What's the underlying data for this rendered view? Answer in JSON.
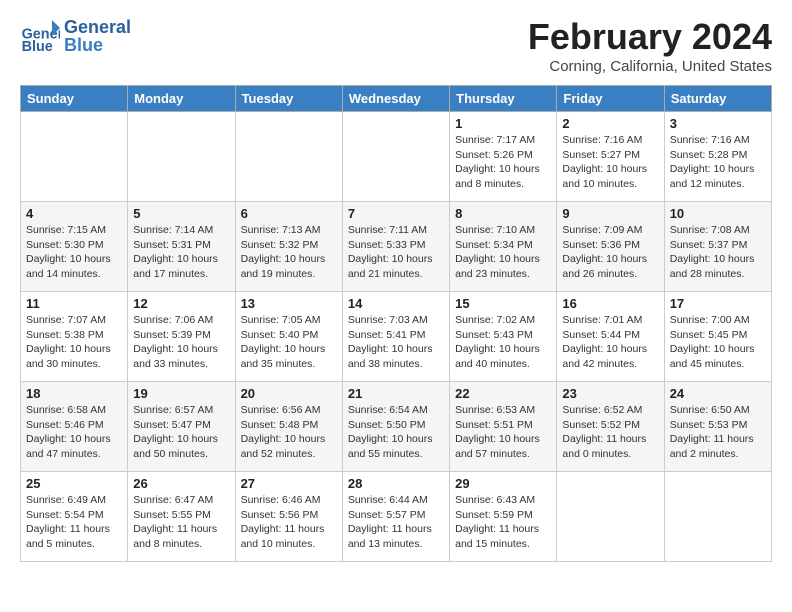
{
  "header": {
    "logo_text_general": "General",
    "logo_text_blue": "Blue",
    "month_title": "February 2024",
    "location": "Corning, California, United States"
  },
  "days_of_week": [
    "Sunday",
    "Monday",
    "Tuesday",
    "Wednesday",
    "Thursday",
    "Friday",
    "Saturday"
  ],
  "weeks": [
    [
      {
        "day": "",
        "info": ""
      },
      {
        "day": "",
        "info": ""
      },
      {
        "day": "",
        "info": ""
      },
      {
        "day": "",
        "info": ""
      },
      {
        "day": "1",
        "info": "Sunrise: 7:17 AM\nSunset: 5:26 PM\nDaylight: 10 hours\nand 8 minutes."
      },
      {
        "day": "2",
        "info": "Sunrise: 7:16 AM\nSunset: 5:27 PM\nDaylight: 10 hours\nand 10 minutes."
      },
      {
        "day": "3",
        "info": "Sunrise: 7:16 AM\nSunset: 5:28 PM\nDaylight: 10 hours\nand 12 minutes."
      }
    ],
    [
      {
        "day": "4",
        "info": "Sunrise: 7:15 AM\nSunset: 5:30 PM\nDaylight: 10 hours\nand 14 minutes."
      },
      {
        "day": "5",
        "info": "Sunrise: 7:14 AM\nSunset: 5:31 PM\nDaylight: 10 hours\nand 17 minutes."
      },
      {
        "day": "6",
        "info": "Sunrise: 7:13 AM\nSunset: 5:32 PM\nDaylight: 10 hours\nand 19 minutes."
      },
      {
        "day": "7",
        "info": "Sunrise: 7:11 AM\nSunset: 5:33 PM\nDaylight: 10 hours\nand 21 minutes."
      },
      {
        "day": "8",
        "info": "Sunrise: 7:10 AM\nSunset: 5:34 PM\nDaylight: 10 hours\nand 23 minutes."
      },
      {
        "day": "9",
        "info": "Sunrise: 7:09 AM\nSunset: 5:36 PM\nDaylight: 10 hours\nand 26 minutes."
      },
      {
        "day": "10",
        "info": "Sunrise: 7:08 AM\nSunset: 5:37 PM\nDaylight: 10 hours\nand 28 minutes."
      }
    ],
    [
      {
        "day": "11",
        "info": "Sunrise: 7:07 AM\nSunset: 5:38 PM\nDaylight: 10 hours\nand 30 minutes."
      },
      {
        "day": "12",
        "info": "Sunrise: 7:06 AM\nSunset: 5:39 PM\nDaylight: 10 hours\nand 33 minutes."
      },
      {
        "day": "13",
        "info": "Sunrise: 7:05 AM\nSunset: 5:40 PM\nDaylight: 10 hours\nand 35 minutes."
      },
      {
        "day": "14",
        "info": "Sunrise: 7:03 AM\nSunset: 5:41 PM\nDaylight: 10 hours\nand 38 minutes."
      },
      {
        "day": "15",
        "info": "Sunrise: 7:02 AM\nSunset: 5:43 PM\nDaylight: 10 hours\nand 40 minutes."
      },
      {
        "day": "16",
        "info": "Sunrise: 7:01 AM\nSunset: 5:44 PM\nDaylight: 10 hours\nand 42 minutes."
      },
      {
        "day": "17",
        "info": "Sunrise: 7:00 AM\nSunset: 5:45 PM\nDaylight: 10 hours\nand 45 minutes."
      }
    ],
    [
      {
        "day": "18",
        "info": "Sunrise: 6:58 AM\nSunset: 5:46 PM\nDaylight: 10 hours\nand 47 minutes."
      },
      {
        "day": "19",
        "info": "Sunrise: 6:57 AM\nSunset: 5:47 PM\nDaylight: 10 hours\nand 50 minutes."
      },
      {
        "day": "20",
        "info": "Sunrise: 6:56 AM\nSunset: 5:48 PM\nDaylight: 10 hours\nand 52 minutes."
      },
      {
        "day": "21",
        "info": "Sunrise: 6:54 AM\nSunset: 5:50 PM\nDaylight: 10 hours\nand 55 minutes."
      },
      {
        "day": "22",
        "info": "Sunrise: 6:53 AM\nSunset: 5:51 PM\nDaylight: 10 hours\nand 57 minutes."
      },
      {
        "day": "23",
        "info": "Sunrise: 6:52 AM\nSunset: 5:52 PM\nDaylight: 11 hours\nand 0 minutes."
      },
      {
        "day": "24",
        "info": "Sunrise: 6:50 AM\nSunset: 5:53 PM\nDaylight: 11 hours\nand 2 minutes."
      }
    ],
    [
      {
        "day": "25",
        "info": "Sunrise: 6:49 AM\nSunset: 5:54 PM\nDaylight: 11 hours\nand 5 minutes."
      },
      {
        "day": "26",
        "info": "Sunrise: 6:47 AM\nSunset: 5:55 PM\nDaylight: 11 hours\nand 8 minutes."
      },
      {
        "day": "27",
        "info": "Sunrise: 6:46 AM\nSunset: 5:56 PM\nDaylight: 11 hours\nand 10 minutes."
      },
      {
        "day": "28",
        "info": "Sunrise: 6:44 AM\nSunset: 5:57 PM\nDaylight: 11 hours\nand 13 minutes."
      },
      {
        "day": "29",
        "info": "Sunrise: 6:43 AM\nSunset: 5:59 PM\nDaylight: 11 hours\nand 15 minutes."
      },
      {
        "day": "",
        "info": ""
      },
      {
        "day": "",
        "info": ""
      }
    ]
  ]
}
